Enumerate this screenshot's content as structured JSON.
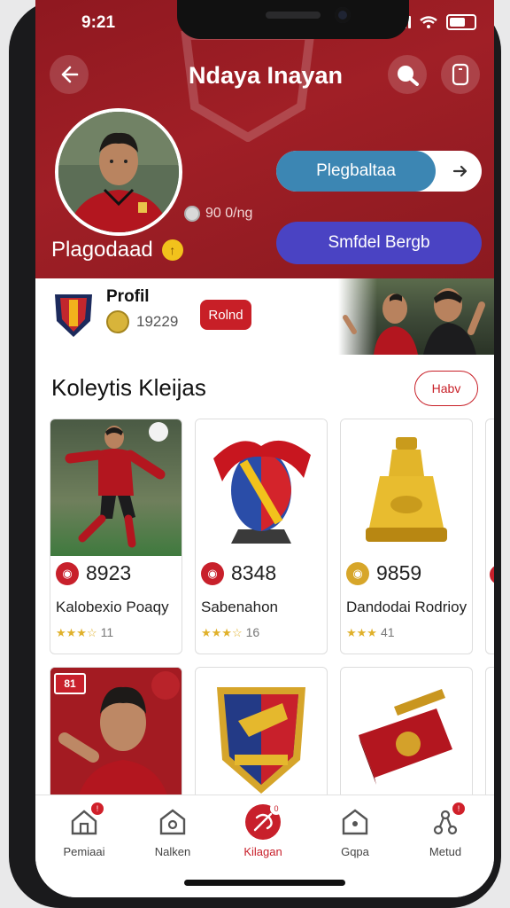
{
  "status_bar": {
    "time": "9:21"
  },
  "header": {
    "title": "Ndaya Inayan",
    "username": "Plagodaad",
    "stat": "90 0/ng"
  },
  "actions": {
    "primary": "Plegbaltaa",
    "secondary": "Smfdel Bergb"
  },
  "profile_strip": {
    "label": "Profil",
    "count": "19229",
    "badge": "Rolnd"
  },
  "collection": {
    "title": "Koleytis Kleijas",
    "view_all": "Habv",
    "items": [
      {
        "price": "8923",
        "name": "Kalobexio Poaqy",
        "rating_count": "11",
        "coin_color": "#c8202b"
      },
      {
        "price": "8348",
        "name": "Sabenahon",
        "rating_count": "16",
        "coin_color": "#c8202b"
      },
      {
        "price": "9859",
        "name": "Dandodai Rodrioy",
        "rating_count": "41",
        "coin_color": "#d7a62a"
      }
    ],
    "row2_badge": "81"
  },
  "tabbar": {
    "items": [
      {
        "label": "Pemiaai"
      },
      {
        "label": "Nalken"
      },
      {
        "label": "Kilagan"
      },
      {
        "label": "Gqpa"
      },
      {
        "label": "Metud"
      }
    ]
  },
  "colors": {
    "accent": "#a01f26",
    "primary_pill": "#3c86b3",
    "secondary_pill": "#4a43c3"
  }
}
